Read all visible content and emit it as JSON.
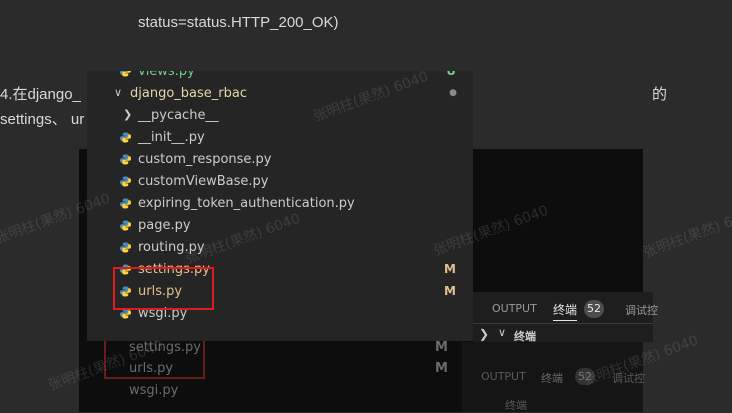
{
  "document": {
    "code_line": "status=status.HTTP_200_OK)",
    "para_line1_start": "4.在django_",
    "para_line1_end": "的",
    "para_line2_start": "settings、 ur"
  },
  "explorer": {
    "rows": [
      {
        "label": "views.py",
        "status": "U",
        "status_color": "#73c991",
        "type": "file"
      },
      {
        "label": "django_base_rbac",
        "status": "●",
        "status_color": "#8a8a8a",
        "type": "folder-open"
      },
      {
        "label": "__pycache__",
        "status": "",
        "type": "folder-closed"
      },
      {
        "label": "__init__.py",
        "status": "",
        "type": "file"
      },
      {
        "label": "custom_response.py",
        "status": "",
        "type": "file"
      },
      {
        "label": "customViewBase.py",
        "status": "",
        "type": "file"
      },
      {
        "label": "expiring_token_authentication.py",
        "status": "",
        "type": "file"
      },
      {
        "label": "page.py",
        "status": "",
        "type": "file"
      },
      {
        "label": "routing.py",
        "status": "",
        "type": "file"
      },
      {
        "label": "settings.py",
        "status": "M",
        "status_color": "#e2c08d",
        "type": "file"
      },
      {
        "label": "urls.py",
        "status": "M",
        "status_color": "#e2c08d",
        "type": "file"
      },
      {
        "label": "wsgi.py",
        "status": "",
        "type": "file"
      }
    ]
  },
  "ghost": {
    "settings": "settings.py",
    "urls": "urls.py",
    "wsgi": "wsgi.py",
    "m1": "M",
    "m2": "M"
  },
  "panel": {
    "output_tab": "OUTPUT",
    "terminal_tab": "终端",
    "terminal_count": "52",
    "debug_tab": "调试控",
    "terminal_section": "终端"
  },
  "ghost_panel": {
    "output_tab": "OUTPUT",
    "terminal_tab": "终端",
    "terminal_count": "52",
    "debug_tab": "调试控",
    "terminal_section": "终端"
  },
  "watermark": "张明柱(果然) 6040",
  "colors": {
    "python_blue": "#4b8bbe",
    "python_yellow": "#ffd43b",
    "highlight_red": "#e21a1a",
    "modified": "#e2c08d",
    "untracked": "#73c991"
  }
}
